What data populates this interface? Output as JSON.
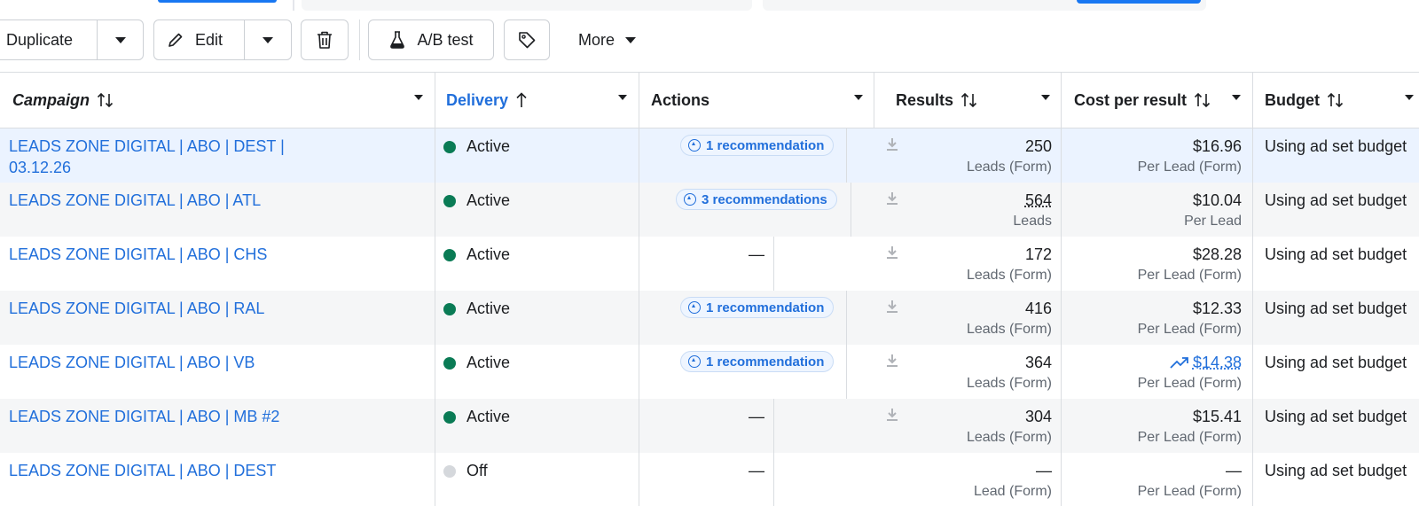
{
  "toolbar": {
    "duplicate_label": "Duplicate",
    "edit_label": "Edit",
    "ab_test_label": "A/B test",
    "more_label": "More"
  },
  "columns": {
    "campaign": "Campaign",
    "delivery": "Delivery",
    "actions": "Actions",
    "results": "Results",
    "cost_per_result": "Cost per result",
    "budget": "Budget"
  },
  "rows": [
    {
      "campaign": "LEADS ZONE DIGITAL | ABO | DEST | 03.12.26",
      "delivery": "Active",
      "actions": "1 recommendation",
      "results": "250",
      "results_sub": "Leads (Form)",
      "cost": "$16.96",
      "cost_sub": "Per Lead (Form)",
      "budget": "Using ad set budget"
    },
    {
      "campaign": "LEADS ZONE DIGITAL | ABO | ATL",
      "delivery": "Active",
      "actions": "3 recommendations",
      "results": "564",
      "results_sub": "Leads",
      "cost": "$10.04",
      "cost_sub": "Per Lead",
      "budget": "Using ad set budget"
    },
    {
      "campaign": "LEADS ZONE DIGITAL | ABO | CHS",
      "delivery": "Active",
      "actions": "—",
      "results": "172",
      "results_sub": "Leads (Form)",
      "cost": "$28.28",
      "cost_sub": "Per Lead (Form)",
      "budget": "Using ad set budget"
    },
    {
      "campaign": "LEADS ZONE DIGITAL | ABO | RAL",
      "delivery": "Active",
      "actions": "1 recommendation",
      "results": "416",
      "results_sub": "Leads (Form)",
      "cost": "$12.33",
      "cost_sub": "Per Lead (Form)",
      "budget": "Using ad set budget"
    },
    {
      "campaign": "LEADS ZONE DIGITAL | ABO | VB",
      "delivery": "Active",
      "actions": "1 recommendation",
      "results": "364",
      "results_sub": "Leads (Form)",
      "cost": "$14.38",
      "cost_sub": "Per Lead (Form)",
      "budget": "Using ad set budget"
    },
    {
      "campaign": "LEADS ZONE DIGITAL | ABO | MB #2",
      "delivery": "Active",
      "actions": "—",
      "results": "304",
      "results_sub": "Leads (Form)",
      "cost": "$15.41",
      "cost_sub": "Per Lead (Form)",
      "budget": "Using ad set budget"
    },
    {
      "campaign": "LEADS ZONE DIGITAL | ABO | DEST",
      "delivery": "Off",
      "actions": "—",
      "results": "—",
      "results_sub": "Lead (Form)",
      "cost": "—",
      "cost_sub": "Per Lead (Form)",
      "budget": "Using ad set budget"
    }
  ],
  "colors": {
    "link_blue": "#216fdb",
    "active_green": "#0a7b55",
    "off_gray": "#d5d8dc",
    "accent_blue": "#1877f2"
  }
}
